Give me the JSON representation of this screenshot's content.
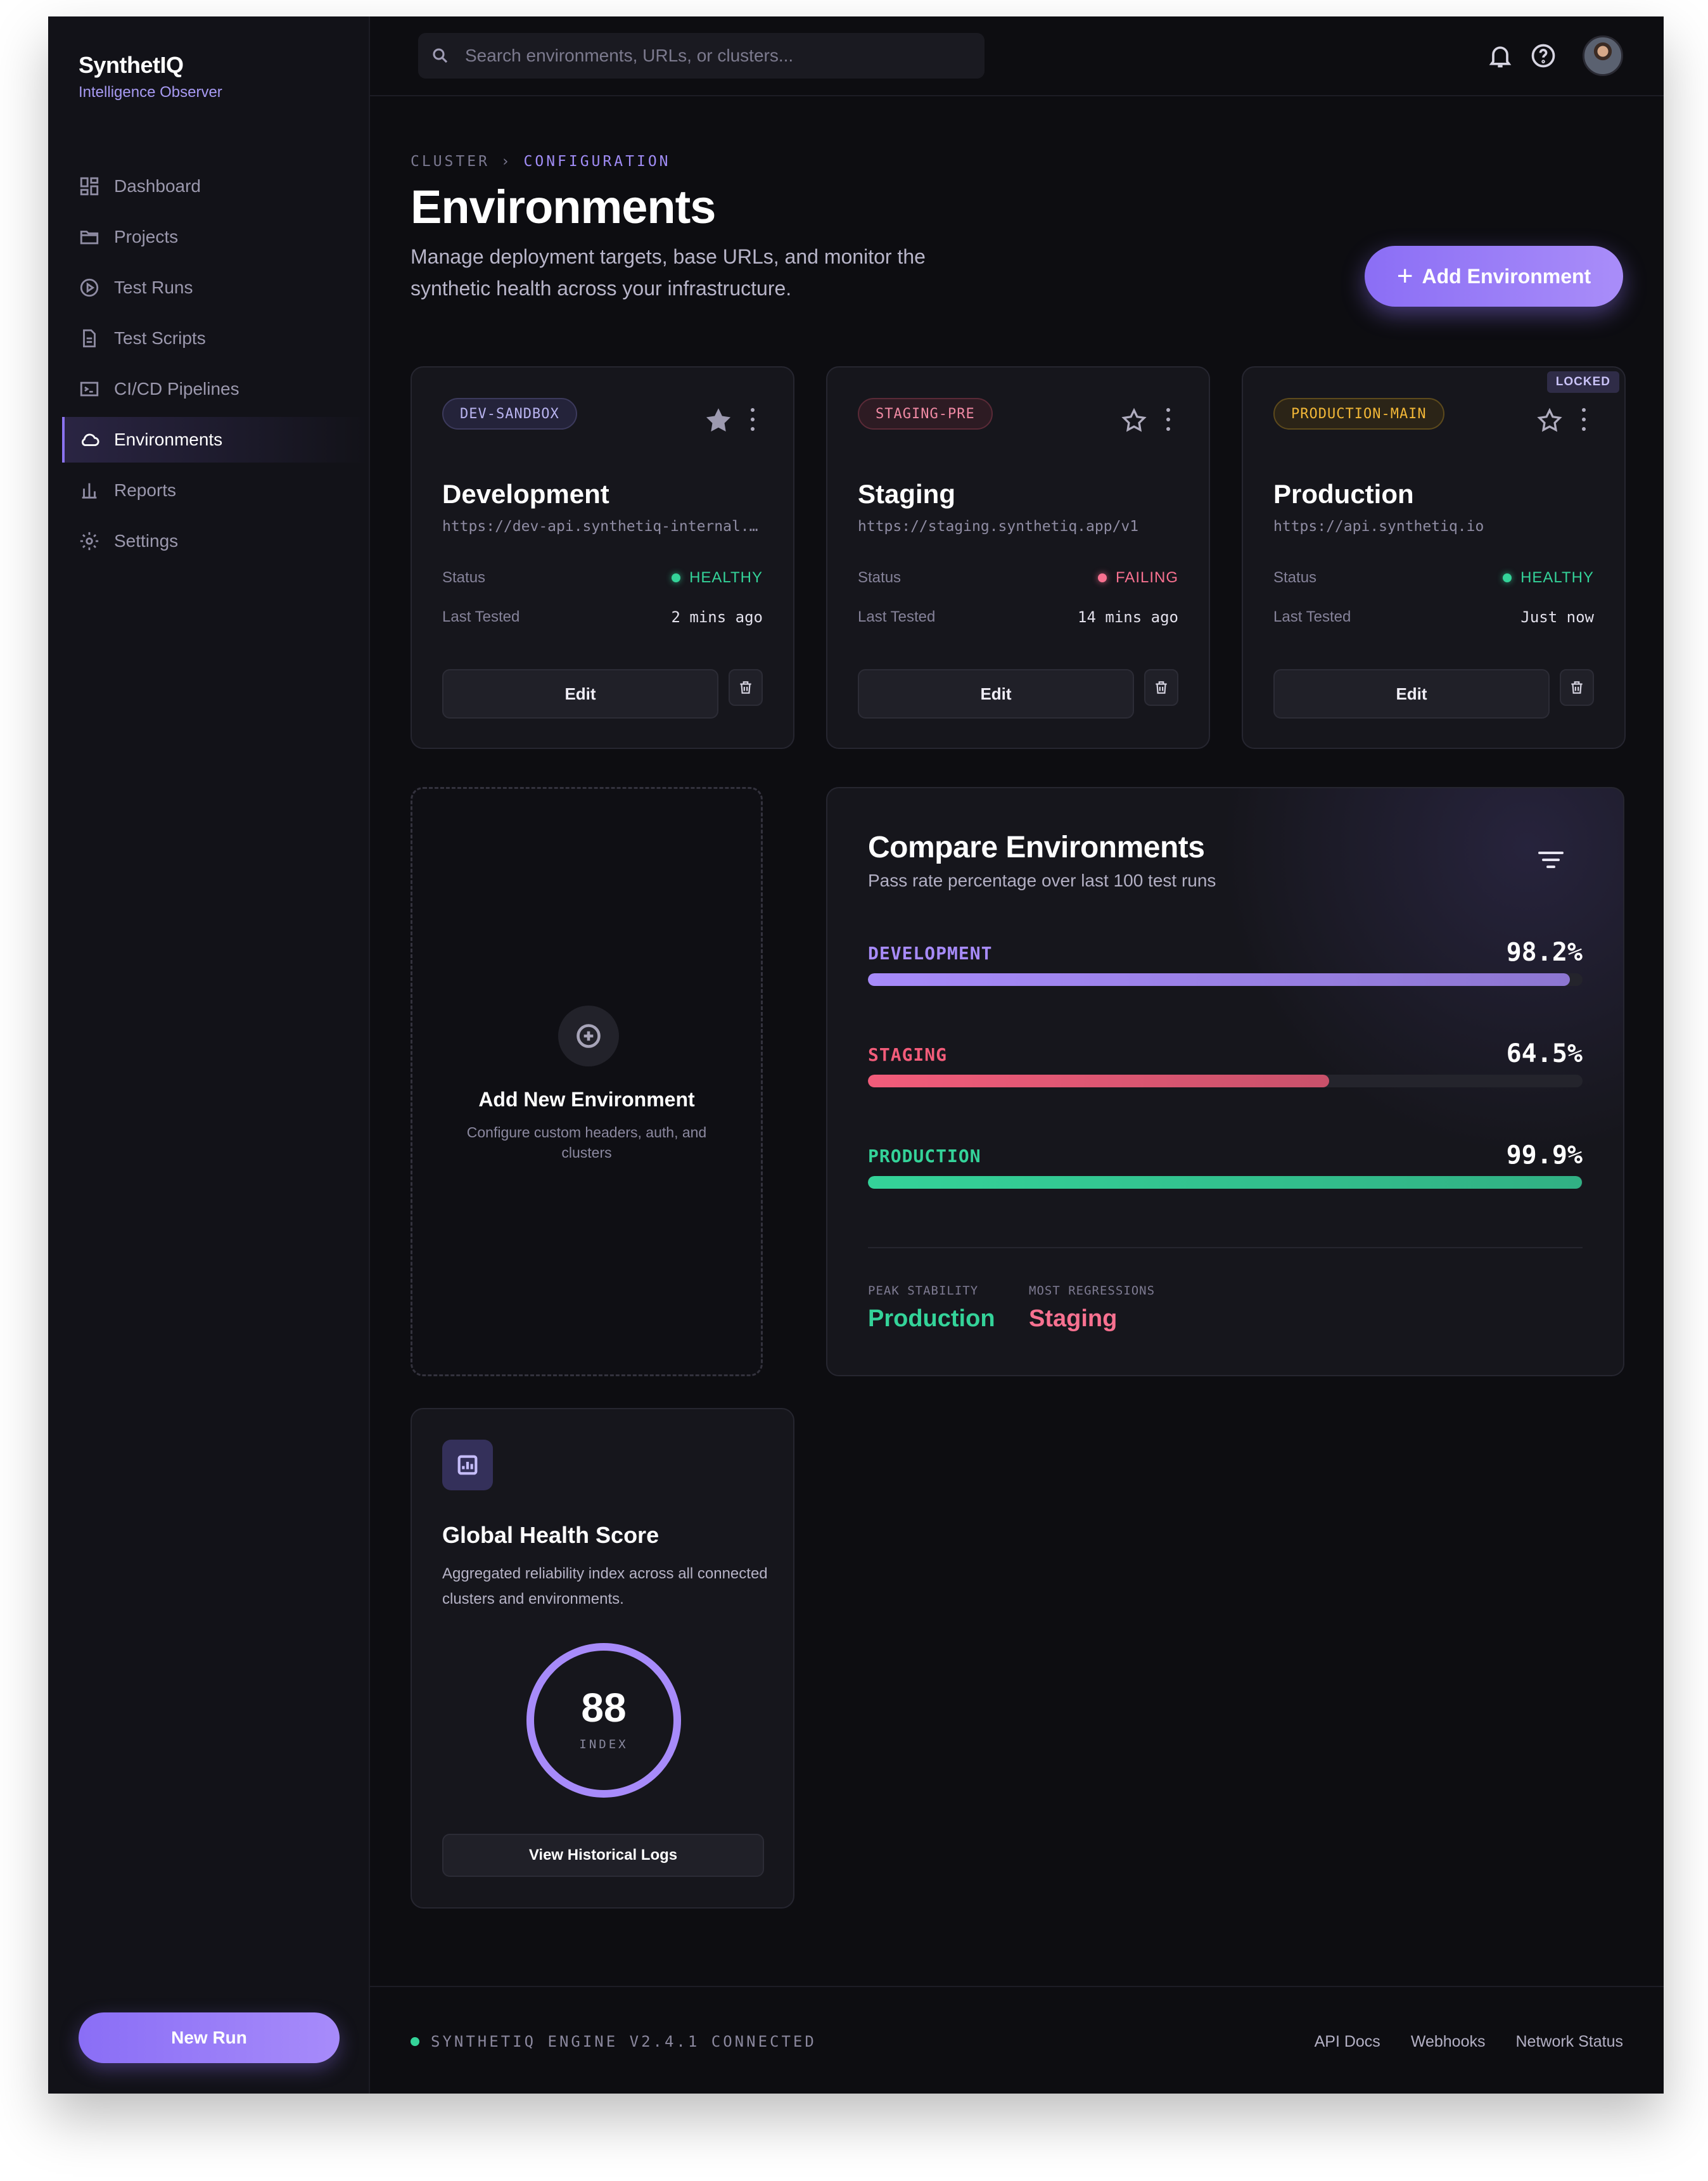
{
  "brand": {
    "name": "SynthetIQ",
    "subtitle": "Intelligence Observer"
  },
  "sidebar": {
    "items": [
      {
        "label": "Dashboard",
        "icon": "dashboard-icon"
      },
      {
        "label": "Projects",
        "icon": "folder-icon"
      },
      {
        "label": "Test Runs",
        "icon": "play-circle-icon"
      },
      {
        "label": "Test Scripts",
        "icon": "document-icon"
      },
      {
        "label": "CI/CD Pipelines",
        "icon": "terminal-icon"
      },
      {
        "label": "Environments",
        "icon": "cloud-icon",
        "active": true
      },
      {
        "label": "Reports",
        "icon": "bar-chart-icon"
      },
      {
        "label": "Settings",
        "icon": "gear-icon"
      }
    ],
    "new_run": "New Run"
  },
  "topbar": {
    "search_placeholder": "Search environments, URLs, or clusters..."
  },
  "header": {
    "breadcrumb_root": "CLUSTER",
    "breadcrumb_sep": "›",
    "breadcrumb_current": "CONFIGURATION",
    "title": "Environments",
    "description": "Manage deployment targets, base URLs, and monitor the synthetic health across your infrastructure.",
    "add_button": "Add Environment"
  },
  "environments": [
    {
      "tag": "DEV-SANDBOX",
      "name": "Development",
      "url": "https://dev-api.synthetiq-internal.com",
      "status_label": "Status",
      "status": "HEALTHY",
      "last_tested_label": "Last Tested",
      "last_tested": "2 mins ago",
      "edit": "Edit",
      "starred": true
    },
    {
      "tag": "STAGING-PRE",
      "name": "Staging",
      "url": "https://staging.synthetiq.app/v1",
      "status_label": "Status",
      "status": "FAILING",
      "last_tested_label": "Last Tested",
      "last_tested": "14 mins ago",
      "edit": "Edit",
      "starred": false
    },
    {
      "tag": "PRODUCTION-MAIN",
      "name": "Production",
      "url": "https://api.synthetiq.io",
      "status_label": "Status",
      "status": "HEALTHY",
      "last_tested_label": "Last Tested",
      "last_tested": "Just now",
      "edit": "Edit",
      "starred": false,
      "badge": "LOCKED"
    }
  ],
  "add_new": {
    "title": "Add New Environment",
    "subtitle": "Configure custom headers, auth, and clusters"
  },
  "compare": {
    "title": "Compare Environments",
    "subtitle": "Pass rate percentage over last 100 test runs",
    "bars": [
      {
        "label": "DEVELOPMENT",
        "value_text": "98.2%",
        "value": 98.2,
        "color": "#a78bfa"
      },
      {
        "label": "STAGING",
        "value_text": "64.5%",
        "value": 64.5,
        "color": "#f25c7a"
      },
      {
        "label": "PRODUCTION",
        "value_text": "99.9%",
        "value": 99.9,
        "color": "#34d399"
      }
    ],
    "peak_label": "PEAK STABILITY",
    "peak_value": "Production",
    "regress_label": "MOST REGRESSIONS",
    "regress_value": "Staging"
  },
  "health": {
    "title": "Global Health Score",
    "description": "Aggregated reliability index across all connected clusters and environments.",
    "score": "88",
    "score_label": "INDEX",
    "button": "View Historical Logs"
  },
  "footer": {
    "engine": "SYNTHETIQ ENGINE V2.4.1 CONNECTED",
    "links": [
      "API Docs",
      "Webhooks",
      "Network Status"
    ]
  },
  "colors": {
    "accent": "#8b73f0",
    "healthy": "#34d399",
    "failing": "#f87190",
    "warning": "#f2b737"
  }
}
